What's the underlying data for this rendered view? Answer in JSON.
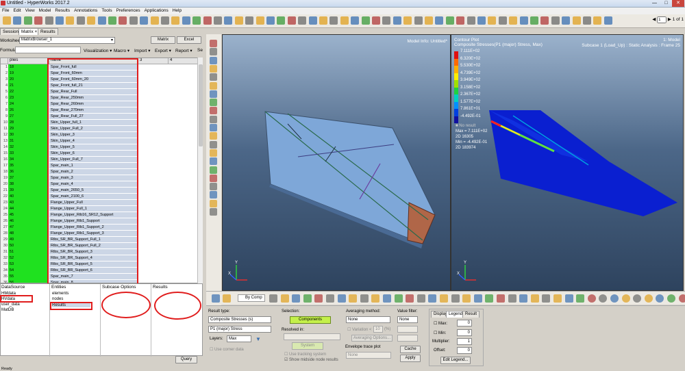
{
  "window": {
    "title": "Untitled - HyperWorks 2017.2"
  },
  "menu": [
    "File",
    "Edit",
    "View",
    "Model",
    "Results",
    "Annotations",
    "Tools",
    "Preferences",
    "Applications",
    "Help"
  ],
  "pager": {
    "value": "1",
    "label": "1 of 1"
  },
  "tabs": [
    "Session",
    "Matrix",
    "Results"
  ],
  "tab_close": "×",
  "worksheet": {
    "label": "Worksheet:",
    "value": "MatrixBrowser_1",
    "matrix_btn": "Matrix",
    "excel_btn": "Excel"
  },
  "formula": {
    "label": "Formula:"
  },
  "grid_menus": [
    "Visualization ▾",
    "Macro ▾",
    "Import ▾",
    "Export ▾",
    "Report ▾",
    "Se"
  ],
  "grid": {
    "headers": [
      "plies",
      "name",
      "3",
      "4"
    ],
    "rows": [
      {
        "n": "1",
        "ply": "18",
        "name": "Spar_Front_full"
      },
      {
        "n": "2",
        "ply": "19",
        "name": "Spar_Front_60mm"
      },
      {
        "n": "3",
        "ply": "20",
        "name": "Spar_Front_60mm_20"
      },
      {
        "n": "4",
        "ply": "21",
        "name": "Spar_Front_full_21"
      },
      {
        "n": "5",
        "ply": "22",
        "name": "Spar_Rear_Full"
      },
      {
        "n": "6",
        "ply": "23",
        "name": "Spar_Rear_250mm"
      },
      {
        "n": "7",
        "ply": "24",
        "name": "Spar_Rear_260mm"
      },
      {
        "n": "8",
        "ply": "26",
        "name": "Spar_Rear_270mm"
      },
      {
        "n": "9",
        "ply": "27",
        "name": "Spar_Rear_Full_27"
      },
      {
        "n": "10",
        "ply": "28",
        "name": "Skin_Upper_full_1"
      },
      {
        "n": "11",
        "ply": "29",
        "name": "Skin_Upper_Full_2"
      },
      {
        "n": "12",
        "ply": "30",
        "name": "Skin_Upper_3"
      },
      {
        "n": "13",
        "ply": "31",
        "name": "Skin_Upper_4"
      },
      {
        "n": "14",
        "ply": "32",
        "name": "Skin_Upper_5"
      },
      {
        "n": "15",
        "ply": "33",
        "name": "Skin_Upper_6"
      },
      {
        "n": "16",
        "ply": "34",
        "name": "Skin_Upper_Full_7"
      },
      {
        "n": "17",
        "ply": "35",
        "name": "Spar_main_1"
      },
      {
        "n": "18",
        "ply": "36",
        "name": "Spar_main_2"
      },
      {
        "n": "19",
        "ply": "37",
        "name": "Spar_main_3"
      },
      {
        "n": "20",
        "ply": "38",
        "name": "Spar_main_4"
      },
      {
        "n": "21",
        "ply": "39",
        "name": "Spar_main_2650_5"
      },
      {
        "n": "22",
        "ply": "40",
        "name": "Spar_main_2100_6"
      },
      {
        "n": "23",
        "ply": "43",
        "name": "Flange_Upper_Full"
      },
      {
        "n": "24",
        "ply": "44",
        "name": "Flange_Upper_Full_1"
      },
      {
        "n": "25",
        "ply": "45",
        "name": "Flange_Upper_Rib16_SR12_Support"
      },
      {
        "n": "26",
        "ply": "46",
        "name": "Flange_Upper_Rib1_Support"
      },
      {
        "n": "27",
        "ply": "47",
        "name": "Flange_Upper_Rib1_Support_2"
      },
      {
        "n": "28",
        "ply": "48",
        "name": "Flange_Upper_Rib1_Support_3"
      },
      {
        "n": "29",
        "ply": "49",
        "name": "Ribs_SR_BR_Support_Full_1"
      },
      {
        "n": "30",
        "ply": "50",
        "name": "Ribs_SR_BR_Support_Full_2"
      },
      {
        "n": "31",
        "ply": "51",
        "name": "Ribs_SR_BR_Support_3"
      },
      {
        "n": "32",
        "ply": "52",
        "name": "Ribs_SR_BR_Support_4"
      },
      {
        "n": "33",
        "ply": "53",
        "name": "Ribs_SR_BR_Support_5"
      },
      {
        "n": "34",
        "ply": "54",
        "name": "Ribs_SR_BR_Support_6"
      },
      {
        "n": "35",
        "ply": "55",
        "name": "Spar_main_7"
      },
      {
        "n": "36",
        "ply": "56",
        "name": "Spar_main_8"
      }
    ]
  },
  "browser": {
    "headers": [
      "DataSource",
      "Entities",
      "Subcase Options",
      "Results"
    ],
    "datasources": [
      "HMdata",
      "HVdata",
      "user_data",
      "MatDB"
    ],
    "entities": [
      "elements",
      "nodes",
      "Results"
    ],
    "query_btn": "Query"
  },
  "viewport1": {
    "model_info": "Model Info: Untitled*"
  },
  "viewport2": {
    "title": "Contour Plot",
    "subtitle": "Composite Stresses(P1 (major) Stress, Max)",
    "model": "1: Model",
    "subcase": "Subcase 1 (Load_Up) : Static Analysis : Frame 25",
    "legend_values": [
      "7.111E+02",
      "6.320E+02",
      "5.530E+02",
      "4.739E+02",
      "3.949E+02",
      "3.158E+02",
      "2.367E+02",
      "1.577E+02",
      "7.861E+01",
      "-4.492E-01"
    ],
    "legend_colors": [
      "#e01010",
      "#ff6a00",
      "#ffb000",
      "#ffee00",
      "#a0e000",
      "#20d040",
      "#00d0c0",
      "#0090ff",
      "#0040e0",
      "#1010a0"
    ],
    "no_result": "No result",
    "max_line": "Max = 7.111E+02",
    "max_id": "2D 16305",
    "min_line": "Min = -4.492E-01",
    "min_id": "2D 183974"
  },
  "bottom_toolbar": {
    "comp_label": "By Comp"
  },
  "panel": {
    "result_type_label": "Result type:",
    "result_type": "Composite Stresses (s)",
    "result_comp": "P1 (major) Stress",
    "layers_label": "Layers:",
    "layers_value": "Max",
    "use_corner": "Use corner data",
    "selection_label": "Selection:",
    "components_btn": "Components",
    "resolved_label": "Resolved in:",
    "system_btn": "System",
    "tracking": "Use tracking system",
    "midside": "Show midside node results",
    "averaging_label": "Averaging method:",
    "averaging_value": "None",
    "variation_label": "Variation <",
    "variation_value": "10",
    "variation_unit": "(%)",
    "averaging_options": "Averaging Options...",
    "envelope_label": "Envelope trace plot",
    "envelope_value": "None",
    "value_filter_label": "Value filter:",
    "value_filter": "None",
    "cache_btn": "Cache",
    "apply_btn": "Apply",
    "sub_tabs": [
      "Display",
      "Legend",
      "Result"
    ],
    "max_label": "Max:",
    "min_label": "Min:",
    "max_val": "0",
    "min_val": "0",
    "multiplier_label": "Multiplier:",
    "multiplier_val": "1",
    "offset_label": "Offset:",
    "offset_val": "0",
    "edit_legend": "Edit Legend..."
  },
  "status": "Ready"
}
